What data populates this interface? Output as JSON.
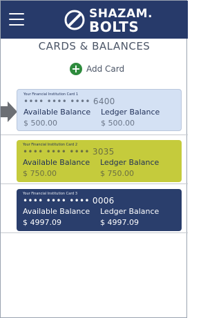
{
  "app": {
    "logo_line1": "SHAZAM.",
    "logo_line2": "BOLTS"
  },
  "page": {
    "title": "CARDS & BALANCES",
    "add_card_label": "Add Card"
  },
  "cards": [
    {
      "institution": "Your Financial Institution Card 1",
      "number": "•••• •••• •••• 6400",
      "available_label": "Available Balance",
      "available_value": "$  500.00",
      "ledger_label": "Ledger Balance",
      "ledger_value": "$  500.00",
      "color": "#d4e1f4"
    },
    {
      "institution": "Your Financial Institution Card 2",
      "number": "•••• •••• •••• 3035",
      "available_label": "Available Balance",
      "available_value": "$  750.00",
      "ledger_label": "Ledger Balance",
      "ledger_value": "$  750.00",
      "color": "#c5cb3c"
    },
    {
      "institution": "Your Financial Institution Card 3",
      "number": "•••• •••• •••• 0006",
      "available_label": "Available Balance",
      "available_value": "$ 4997.09",
      "ledger_label": "Ledger Balance",
      "ledger_value": "$ 4997.09",
      "color": "#2a3e6c"
    }
  ],
  "colors": {
    "header": "#273a6a",
    "add_icon": "#2e8b3d",
    "pointer": "#6c6f74"
  },
  "icons": {
    "menu": "hamburger-menu-icon",
    "logo": "bolt-logo-icon",
    "add": "plus-circle-icon",
    "pointer": "arrow-right-icon"
  }
}
